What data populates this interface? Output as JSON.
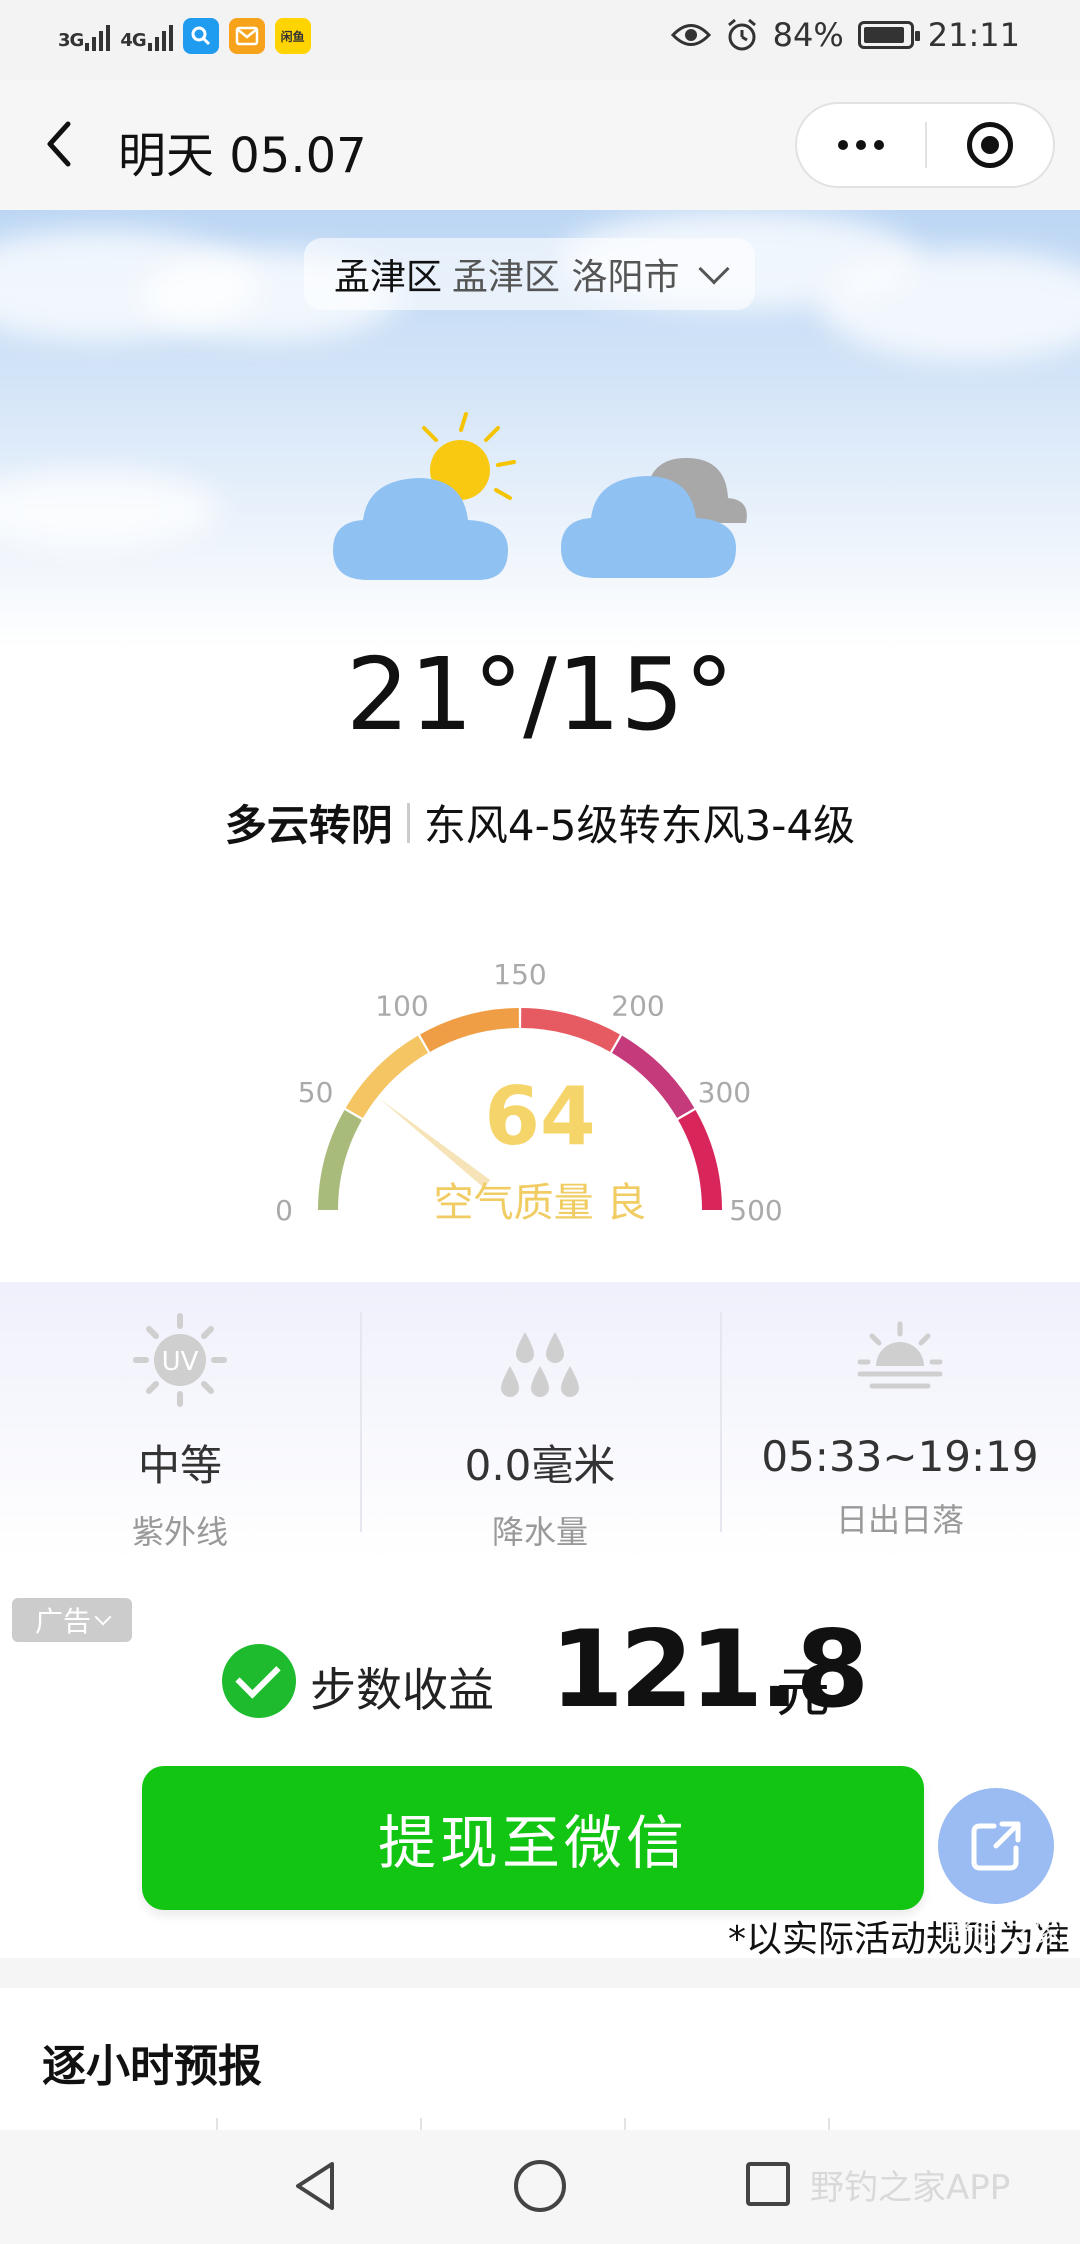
{
  "status_bar": {
    "signal_1": "3G",
    "signal_2": "4G",
    "app_icon_label": "闲鱼",
    "battery": "84%",
    "time": "21:11"
  },
  "header": {
    "title": "明天  05.07",
    "more_icon": "more-dots-icon",
    "close_icon": "target-circle-icon"
  },
  "location": {
    "main": "孟津区",
    "sub": "孟津区 洛阳市"
  },
  "weather": {
    "icons": [
      "partly-cloudy-icon",
      "overcast-icon"
    ],
    "temperature": "21°/15°",
    "condition": "多云转阴",
    "wind": "东风4-5级转东风3-4级"
  },
  "aqi": {
    "value": 64,
    "label": "空气质量 良",
    "scale_labels": [
      "0",
      "50",
      "100",
      "150",
      "200",
      "300",
      "500"
    ],
    "scale_max": 500,
    "colors": {
      "0-50": "#a9bb7b",
      "50-100": "#f5c563",
      "100-150": "#ef9e45",
      "150-200": "#e65b62",
      "200-300": "#c43a7a",
      "300-500": "#d8265a"
    }
  },
  "stats": [
    {
      "icon": "uv-sun-icon",
      "value": "中等",
      "label": "紫外线"
    },
    {
      "icon": "raindrops-icon",
      "value": "0.0毫米",
      "label": "降水量"
    },
    {
      "icon": "sunrise-icon",
      "value": "05:33~19:19",
      "label": "日出日落"
    }
  ],
  "ad": {
    "badge": "广告",
    "step_label": "步数收益",
    "amount": "121.8",
    "unit": "元",
    "cta": "提现至微信",
    "note": "*以实际活动规则为准",
    "watermark": "野钓之家",
    "share_icon": "share-icon"
  },
  "hourly": {
    "title": "逐小时预报"
  },
  "nav": {
    "back": "nav-back-icon",
    "home": "nav-home-icon",
    "recent": "nav-recent-icon",
    "watermark": "野钓之家APP"
  },
  "colors": {
    "accent_green": "#13c513",
    "aqi_text": "#f5d46a",
    "share_fab": "#9bbcf3"
  }
}
